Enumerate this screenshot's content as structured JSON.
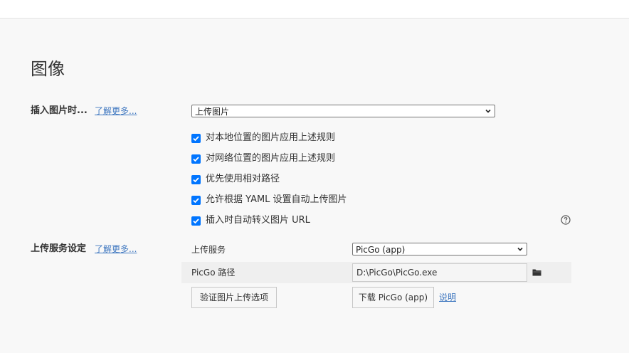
{
  "page_title": "图像",
  "insert_section": {
    "label": "插入图片时...",
    "learn_more": "了解更多...",
    "select_value": "上传图片",
    "options": [
      {
        "label": "对本地位置的图片应用上述规则",
        "checked": true
      },
      {
        "label": "对网络位置的图片应用上述规则",
        "checked": true
      },
      {
        "label": "优先使用相对路径",
        "checked": true
      },
      {
        "label": "允许根据 YAML 设置自动上传图片",
        "checked": true
      },
      {
        "label": "插入时自动转义图片 URL",
        "checked": true
      }
    ],
    "help_icon": "question-circle-icon"
  },
  "upload_section": {
    "label": "上传服务设定",
    "learn_more": "了解更多...",
    "service_label": "上传服务",
    "service_value": "PicGo (app)",
    "path_label": "PicGo 路径",
    "path_value": "D:\\PicGo\\PicGo.exe",
    "folder_icon": "folder-icon",
    "verify_button": "验证图片上传选项",
    "download_button": "下载 PicGo (app)",
    "explain_link": "说明"
  },
  "colors": {
    "checkbox": "#0075ff",
    "link": "#4078c0",
    "background": "#f8f8f8"
  }
}
